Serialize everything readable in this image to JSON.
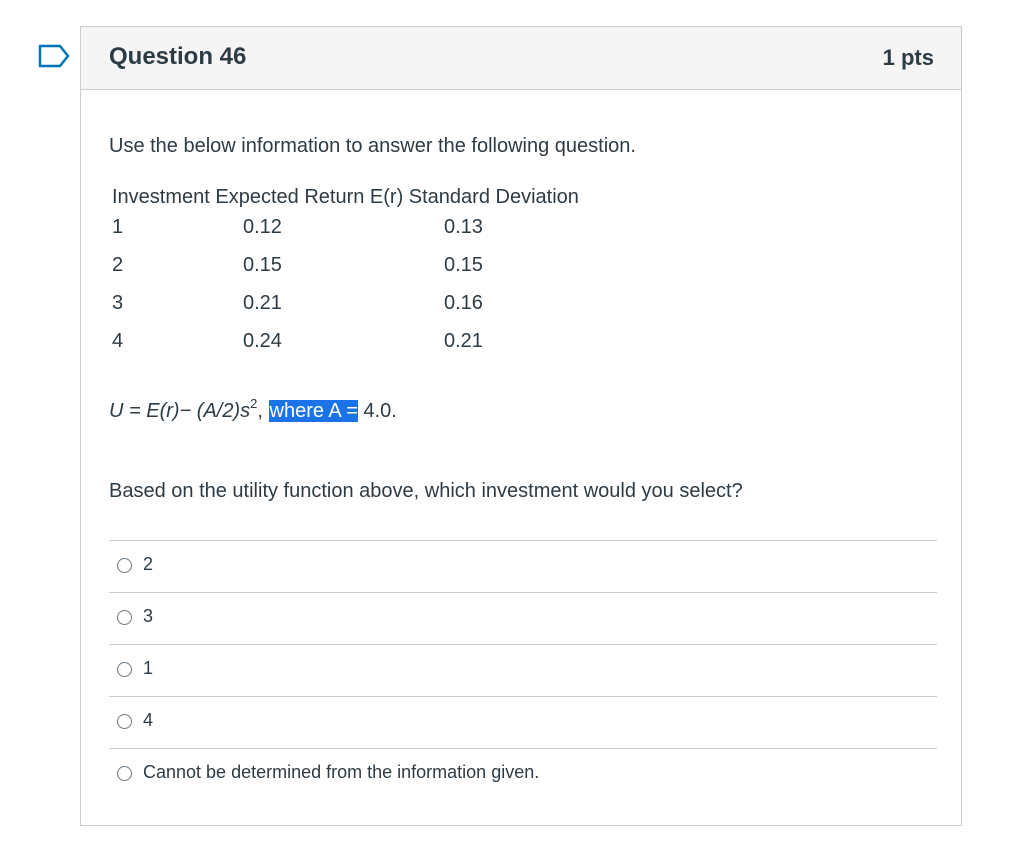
{
  "question": {
    "title": "Question 46",
    "points": "1 pts",
    "intro": "Use the below information to answer the following question.",
    "table": {
      "header": "Investment Expected Return E(r) Standard Deviation",
      "rows": [
        {
          "investment": "1",
          "expected_return": "0.12",
          "std_dev": "0.13"
        },
        {
          "investment": "2",
          "expected_return": "0.15",
          "std_dev": "0.15"
        },
        {
          "investment": "3",
          "expected_return": "0.21",
          "std_dev": "0.16"
        },
        {
          "investment": "4",
          "expected_return": "0.24",
          "std_dev": "0.21"
        }
      ]
    },
    "formula": {
      "main": "U = E(r)− (A/2)s",
      "exponent": "2",
      "separator": ", ",
      "highlighted": "where A =",
      "tail": " 4.0."
    },
    "prompt": "Based on the utility function above, which investment would you select?",
    "answers": [
      {
        "label": "2"
      },
      {
        "label": "3"
      },
      {
        "label": "1"
      },
      {
        "label": "4"
      },
      {
        "label": "Cannot be determined from the information given."
      }
    ]
  },
  "colors": {
    "flag": "#0374b5",
    "header_bg": "#f5f5f5",
    "highlight": "#1a73e8",
    "text": "#2d3b45"
  },
  "icons": {
    "flag": "flag-question-icon"
  }
}
